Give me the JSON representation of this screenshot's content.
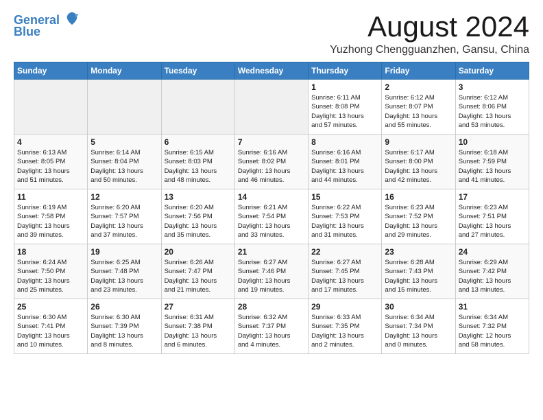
{
  "logo": {
    "line1": "General",
    "line2": "Blue"
  },
  "title": "August 2024",
  "location": "Yuzhong Chengguanzhen, Gansu, China",
  "weekdays": [
    "Sunday",
    "Monday",
    "Tuesday",
    "Wednesday",
    "Thursday",
    "Friday",
    "Saturday"
  ],
  "weeks": [
    [
      {
        "day": "",
        "info": ""
      },
      {
        "day": "",
        "info": ""
      },
      {
        "day": "",
        "info": ""
      },
      {
        "day": "",
        "info": ""
      },
      {
        "day": "1",
        "info": "Sunrise: 6:11 AM\nSunset: 8:08 PM\nDaylight: 13 hours\nand 57 minutes."
      },
      {
        "day": "2",
        "info": "Sunrise: 6:12 AM\nSunset: 8:07 PM\nDaylight: 13 hours\nand 55 minutes."
      },
      {
        "day": "3",
        "info": "Sunrise: 6:12 AM\nSunset: 8:06 PM\nDaylight: 13 hours\nand 53 minutes."
      }
    ],
    [
      {
        "day": "4",
        "info": "Sunrise: 6:13 AM\nSunset: 8:05 PM\nDaylight: 13 hours\nand 51 minutes."
      },
      {
        "day": "5",
        "info": "Sunrise: 6:14 AM\nSunset: 8:04 PM\nDaylight: 13 hours\nand 50 minutes."
      },
      {
        "day": "6",
        "info": "Sunrise: 6:15 AM\nSunset: 8:03 PM\nDaylight: 13 hours\nand 48 minutes."
      },
      {
        "day": "7",
        "info": "Sunrise: 6:16 AM\nSunset: 8:02 PM\nDaylight: 13 hours\nand 46 minutes."
      },
      {
        "day": "8",
        "info": "Sunrise: 6:16 AM\nSunset: 8:01 PM\nDaylight: 13 hours\nand 44 minutes."
      },
      {
        "day": "9",
        "info": "Sunrise: 6:17 AM\nSunset: 8:00 PM\nDaylight: 13 hours\nand 42 minutes."
      },
      {
        "day": "10",
        "info": "Sunrise: 6:18 AM\nSunset: 7:59 PM\nDaylight: 13 hours\nand 41 minutes."
      }
    ],
    [
      {
        "day": "11",
        "info": "Sunrise: 6:19 AM\nSunset: 7:58 PM\nDaylight: 13 hours\nand 39 minutes."
      },
      {
        "day": "12",
        "info": "Sunrise: 6:20 AM\nSunset: 7:57 PM\nDaylight: 13 hours\nand 37 minutes."
      },
      {
        "day": "13",
        "info": "Sunrise: 6:20 AM\nSunset: 7:56 PM\nDaylight: 13 hours\nand 35 minutes."
      },
      {
        "day": "14",
        "info": "Sunrise: 6:21 AM\nSunset: 7:54 PM\nDaylight: 13 hours\nand 33 minutes."
      },
      {
        "day": "15",
        "info": "Sunrise: 6:22 AM\nSunset: 7:53 PM\nDaylight: 13 hours\nand 31 minutes."
      },
      {
        "day": "16",
        "info": "Sunrise: 6:23 AM\nSunset: 7:52 PM\nDaylight: 13 hours\nand 29 minutes."
      },
      {
        "day": "17",
        "info": "Sunrise: 6:23 AM\nSunset: 7:51 PM\nDaylight: 13 hours\nand 27 minutes."
      }
    ],
    [
      {
        "day": "18",
        "info": "Sunrise: 6:24 AM\nSunset: 7:50 PM\nDaylight: 13 hours\nand 25 minutes."
      },
      {
        "day": "19",
        "info": "Sunrise: 6:25 AM\nSunset: 7:48 PM\nDaylight: 13 hours\nand 23 minutes."
      },
      {
        "day": "20",
        "info": "Sunrise: 6:26 AM\nSunset: 7:47 PM\nDaylight: 13 hours\nand 21 minutes."
      },
      {
        "day": "21",
        "info": "Sunrise: 6:27 AM\nSunset: 7:46 PM\nDaylight: 13 hours\nand 19 minutes."
      },
      {
        "day": "22",
        "info": "Sunrise: 6:27 AM\nSunset: 7:45 PM\nDaylight: 13 hours\nand 17 minutes."
      },
      {
        "day": "23",
        "info": "Sunrise: 6:28 AM\nSunset: 7:43 PM\nDaylight: 13 hours\nand 15 minutes."
      },
      {
        "day": "24",
        "info": "Sunrise: 6:29 AM\nSunset: 7:42 PM\nDaylight: 13 hours\nand 13 minutes."
      }
    ],
    [
      {
        "day": "25",
        "info": "Sunrise: 6:30 AM\nSunset: 7:41 PM\nDaylight: 13 hours\nand 10 minutes."
      },
      {
        "day": "26",
        "info": "Sunrise: 6:30 AM\nSunset: 7:39 PM\nDaylight: 13 hours\nand 8 minutes."
      },
      {
        "day": "27",
        "info": "Sunrise: 6:31 AM\nSunset: 7:38 PM\nDaylight: 13 hours\nand 6 minutes."
      },
      {
        "day": "28",
        "info": "Sunrise: 6:32 AM\nSunset: 7:37 PM\nDaylight: 13 hours\nand 4 minutes."
      },
      {
        "day": "29",
        "info": "Sunrise: 6:33 AM\nSunset: 7:35 PM\nDaylight: 13 hours\nand 2 minutes."
      },
      {
        "day": "30",
        "info": "Sunrise: 6:34 AM\nSunset: 7:34 PM\nDaylight: 13 hours\nand 0 minutes."
      },
      {
        "day": "31",
        "info": "Sunrise: 6:34 AM\nSunset: 7:32 PM\nDaylight: 12 hours\nand 58 minutes."
      }
    ]
  ]
}
